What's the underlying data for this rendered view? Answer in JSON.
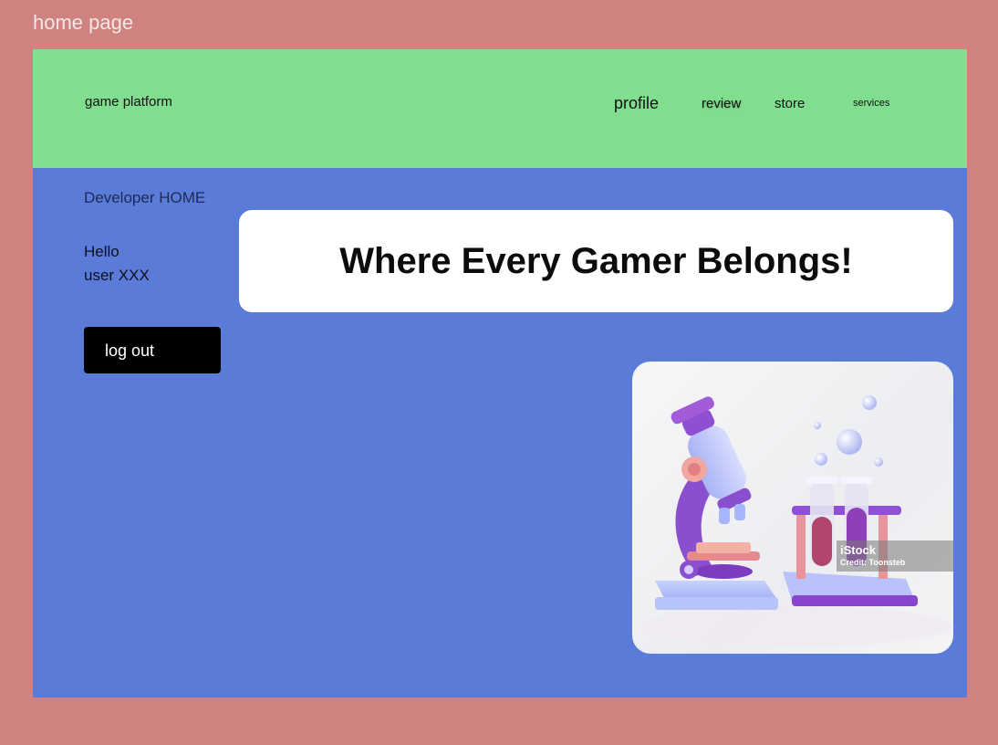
{
  "frame_title": "home page",
  "navbar": {
    "brand": "game platform",
    "items": {
      "profile": "profile",
      "review": "review",
      "store": "store",
      "services": "services"
    },
    "color": "#81de8e"
  },
  "sidebar": {
    "heading": "Developer HOME",
    "greeting_line1": "Hello",
    "greeting_line2": "user XXX",
    "logout_label": "log out"
  },
  "hero": {
    "title": "Where Every Gamer Belongs!"
  },
  "image": {
    "subject": "microscope and test tubes illustration",
    "watermark_brand": "iStock",
    "watermark_credit": "Credit: Toonsteb"
  },
  "colors": {
    "page_background": "#cf827f",
    "content_background": "#5a7cd8",
    "logout_button": "#000000"
  }
}
